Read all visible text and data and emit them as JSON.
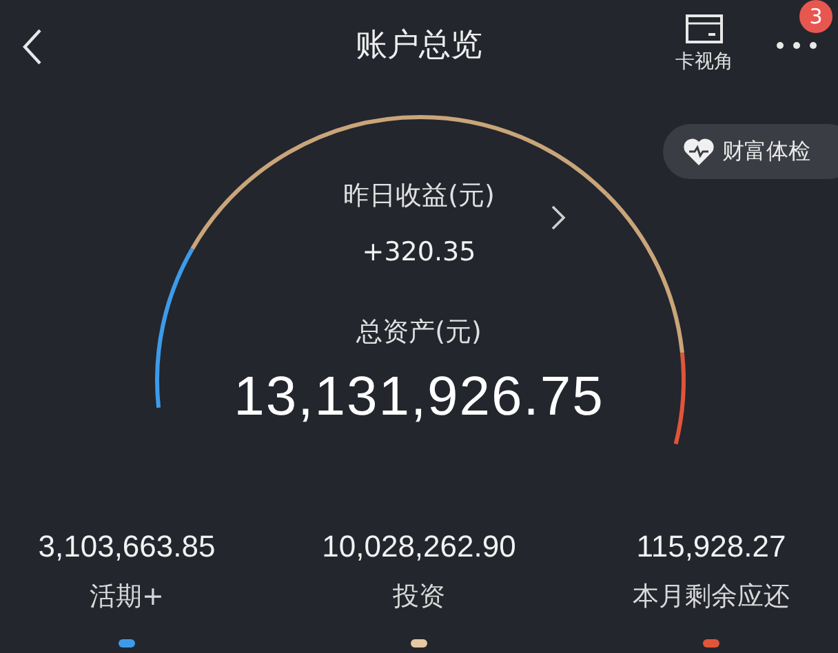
{
  "header": {
    "title": "账户总览",
    "card_view": "卡视角",
    "badge": "3"
  },
  "health_check": "财富体检",
  "yesterday": {
    "label": "昨日收益(元)",
    "value": "+320.35"
  },
  "total": {
    "label": "总资产(元)",
    "value": "13,131,926.75"
  },
  "accounts": [
    {
      "amount": "3,103,663.85",
      "label": "活期+",
      "color": "#3d9be9"
    },
    {
      "amount": "10,028,262.90",
      "label": "投资",
      "color": "#e6c9a3"
    },
    {
      "amount": "115,928.27",
      "label": "本月剩余应还",
      "color": "#e0553a"
    }
  ]
}
